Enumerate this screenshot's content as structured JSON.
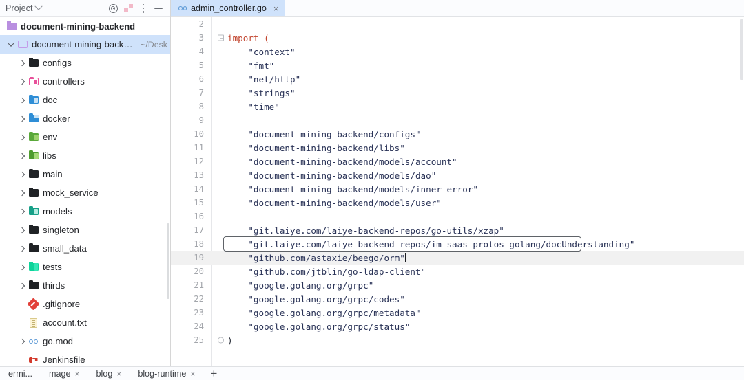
{
  "sidebar": {
    "panel_title": "Project",
    "toolbar_icons": [
      "target-icon",
      "collapse-all-icon",
      "more-options-icon",
      "minimize-icon"
    ],
    "project_root": {
      "label": "document-mining-backend",
      "icon": "project-module-icon"
    },
    "items": [
      {
        "label": "document-mining-backend",
        "path": "~/Desk",
        "icon": "folder-outline-purple",
        "arrow": "open",
        "indent": 0,
        "selected": true
      },
      {
        "label": "configs",
        "path": "",
        "icon": "folder-dark",
        "arrow": "closed",
        "indent": 1,
        "selected": false
      },
      {
        "label": "controllers",
        "path": "",
        "icon": "folder-pink",
        "arrow": "closed",
        "indent": 1,
        "selected": false
      },
      {
        "label": "doc",
        "path": "",
        "icon": "folder-blue",
        "arrow": "closed",
        "indent": 1,
        "selected": false
      },
      {
        "label": "docker",
        "path": "",
        "icon": "folder-docker",
        "arrow": "closed",
        "indent": 1,
        "selected": false
      },
      {
        "label": "env",
        "path": "",
        "icon": "folder-green",
        "arrow": "closed",
        "indent": 1,
        "selected": false
      },
      {
        "label": "libs",
        "path": "",
        "icon": "folder-libs",
        "arrow": "closed",
        "indent": 1,
        "selected": false
      },
      {
        "label": "main",
        "path": "",
        "icon": "folder-dark",
        "arrow": "closed",
        "indent": 1,
        "selected": false
      },
      {
        "label": "mock_service",
        "path": "",
        "icon": "folder-dark",
        "arrow": "closed",
        "indent": 1,
        "selected": false
      },
      {
        "label": "models",
        "path": "",
        "icon": "folder-teal",
        "arrow": "closed",
        "indent": 1,
        "selected": false
      },
      {
        "label": "singleton",
        "path": "",
        "icon": "folder-dark",
        "arrow": "closed",
        "indent": 1,
        "selected": false
      },
      {
        "label": "small_data",
        "path": "",
        "icon": "folder-dark",
        "arrow": "closed",
        "indent": 1,
        "selected": false
      },
      {
        "label": "tests",
        "path": "",
        "icon": "folder-tests",
        "arrow": "closed",
        "indent": 1,
        "selected": false
      },
      {
        "label": "thirds",
        "path": "",
        "icon": "folder-dark",
        "arrow": "closed",
        "indent": 1,
        "selected": false
      },
      {
        "label": ".gitignore",
        "path": "",
        "icon": "git-icon",
        "arrow": "none",
        "indent": 1,
        "selected": false
      },
      {
        "label": "account.txt",
        "path": "",
        "icon": "text-file-icon",
        "arrow": "none",
        "indent": 1,
        "selected": false
      },
      {
        "label": "go.mod",
        "path": "",
        "icon": "go-icon",
        "arrow": "closed",
        "indent": 1,
        "selected": false
      },
      {
        "label": "Jenkinsfile",
        "path": "",
        "icon": "jenkins-icon",
        "arrow": "none",
        "indent": 1,
        "selected": false
      }
    ]
  },
  "editor": {
    "tabs": [
      {
        "label": "admin_controller.go",
        "icon": "go-icon",
        "close": "×",
        "active": true
      }
    ],
    "current_line": 19,
    "highlighted_line": 18,
    "lines": [
      {
        "num": 2,
        "text": "",
        "fold": "",
        "kind": "blank"
      },
      {
        "num": 3,
        "text": "import (",
        "fold": "open",
        "kind": "keyword"
      },
      {
        "num": 4,
        "text": "\"context\"",
        "fold": "",
        "kind": "string",
        "indent": 1
      },
      {
        "num": 5,
        "text": "\"fmt\"",
        "fold": "",
        "kind": "string",
        "indent": 1
      },
      {
        "num": 6,
        "text": "\"net/http\"",
        "fold": "",
        "kind": "string",
        "indent": 1
      },
      {
        "num": 7,
        "text": "\"strings\"",
        "fold": "",
        "kind": "string",
        "indent": 1
      },
      {
        "num": 8,
        "text": "\"time\"",
        "fold": "",
        "kind": "string",
        "indent": 1
      },
      {
        "num": 9,
        "text": "",
        "fold": "",
        "kind": "blank"
      },
      {
        "num": 10,
        "text": "\"document-mining-backend/configs\"",
        "fold": "",
        "kind": "string",
        "indent": 1
      },
      {
        "num": 11,
        "text": "\"document-mining-backend/libs\"",
        "fold": "",
        "kind": "string",
        "indent": 1
      },
      {
        "num": 12,
        "text": "\"document-mining-backend/models/account\"",
        "fold": "",
        "kind": "string",
        "indent": 1
      },
      {
        "num": 13,
        "text": "\"document-mining-backend/models/dao\"",
        "fold": "",
        "kind": "string",
        "indent": 1
      },
      {
        "num": 14,
        "text": "\"document-mining-backend/models/inner_error\"",
        "fold": "",
        "kind": "string",
        "indent": 1
      },
      {
        "num": 15,
        "text": "\"document-mining-backend/models/user\"",
        "fold": "",
        "kind": "string",
        "indent": 1
      },
      {
        "num": 16,
        "text": "",
        "fold": "",
        "kind": "blank"
      },
      {
        "num": 17,
        "text": "\"git.laiye.com/laiye-backend-repos/go-utils/xzap\"",
        "fold": "",
        "kind": "string",
        "indent": 1
      },
      {
        "num": 18,
        "text": "\"git.laiye.com/laiye-backend-repos/im-saas-protos-golang/docUnderstanding\"",
        "fold": "",
        "kind": "string",
        "indent": 1
      },
      {
        "num": 19,
        "text": "\"github.com/astaxie/beego/orm\"",
        "fold": "",
        "kind": "string",
        "indent": 1
      },
      {
        "num": 20,
        "text": "\"github.com/jtblin/go-ldap-client\"",
        "fold": "",
        "kind": "string",
        "indent": 1
      },
      {
        "num": 21,
        "text": "\"google.golang.org/grpc\"",
        "fold": "",
        "kind": "string",
        "indent": 1
      },
      {
        "num": 22,
        "text": "\"google.golang.org/grpc/codes\"",
        "fold": "",
        "kind": "string",
        "indent": 1
      },
      {
        "num": 23,
        "text": "\"google.golang.org/grpc/metadata\"",
        "fold": "",
        "kind": "string",
        "indent": 1
      },
      {
        "num": 24,
        "text": "\"google.golang.org/grpc/status\"",
        "fold": "",
        "kind": "string",
        "indent": 1
      },
      {
        "num": 25,
        "text": ")",
        "fold": "end",
        "kind": "paren"
      }
    ]
  },
  "bottom_bar": {
    "tabs": [
      {
        "label": "ermi...",
        "close": ""
      },
      {
        "label": "mage",
        "close": "×"
      },
      {
        "label": "blog",
        "close": "×"
      },
      {
        "label": "blog-runtime",
        "close": "×"
      }
    ],
    "add_label": "+"
  },
  "colors": {
    "selection": "#cfe2fb",
    "string": "#2a3357",
    "keyword": "#c2452f",
    "line_number": "#a3a6ab",
    "current_line": "#f1f1f1",
    "highlight_border": "#5f6368"
  }
}
